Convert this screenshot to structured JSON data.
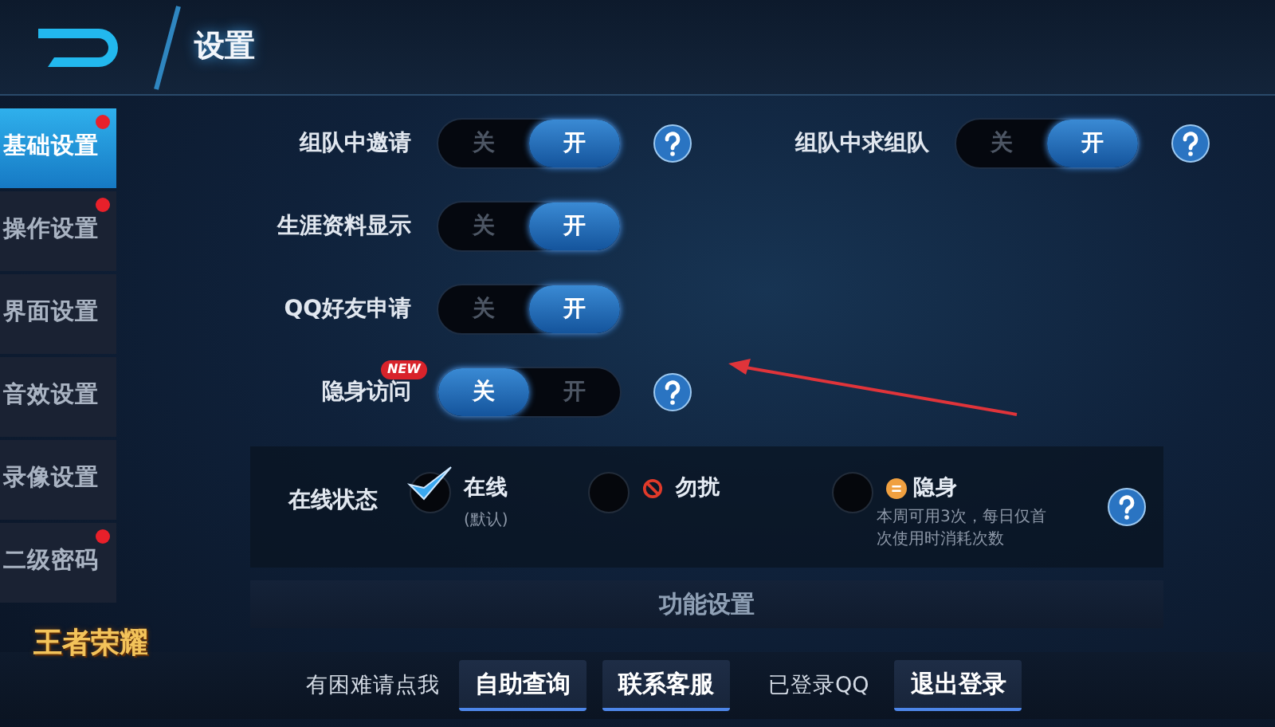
{
  "header": {
    "title": "设置"
  },
  "sidebar": {
    "items": [
      {
        "label": "基础设置",
        "selected": true,
        "dot": true
      },
      {
        "label": "操作设置",
        "selected": false,
        "dot": true
      },
      {
        "label": "界面设置",
        "selected": false,
        "dot": false
      },
      {
        "label": "音效设置",
        "selected": false,
        "dot": false
      },
      {
        "label": "录像设置",
        "selected": false,
        "dot": false
      },
      {
        "label": "二级密码",
        "selected": false,
        "dot": true
      }
    ],
    "logo": "王者荣耀"
  },
  "toggle_rows": [
    [
      {
        "label": "组队中邀请",
        "off_label": "关",
        "on_label": "开",
        "on": true,
        "help": true
      },
      {
        "label": "组队中求组队",
        "off_label": "关",
        "on_label": "开",
        "on": true,
        "help": true
      }
    ],
    [
      {
        "label": "生涯资料显示",
        "off_label": "关",
        "on_label": "开",
        "on": true,
        "help": false
      }
    ],
    [
      {
        "label": "QQ好友申请",
        "off_label": "关",
        "on_label": "开",
        "on": true,
        "help": false
      }
    ],
    [
      {
        "label": "隐身访问",
        "badge": "NEW",
        "off_label": "关",
        "on_label": "开",
        "on": false,
        "help": true
      }
    ]
  ],
  "online_status": {
    "label": "在线状态",
    "options": [
      {
        "label": "在线",
        "kind": "plain",
        "note": "(默认)",
        "selected": true
      },
      {
        "label": "勿扰",
        "kind": "forbidden",
        "selected": false
      },
      {
        "label": "隐身",
        "kind": "hidden",
        "note": "本周可用3次，每日仅首次使用时消耗次数",
        "selected": false
      }
    ],
    "help": true
  },
  "section_bar": "功能设置",
  "footer": {
    "help_text": "有困难请点我",
    "buttons": [
      "自助查询",
      "联系客服"
    ],
    "login_text": "已登录QQ",
    "logout": "退出登录"
  }
}
